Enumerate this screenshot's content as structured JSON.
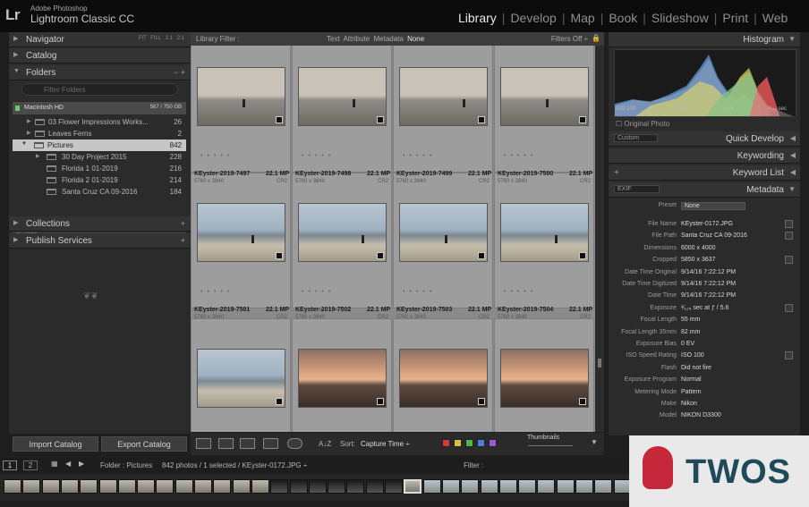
{
  "app": {
    "badge": "Lr",
    "vendor": "Adobe Photoshop",
    "name": "Lightroom Classic CC"
  },
  "modules": [
    "Library",
    "Develop",
    "Map",
    "Book",
    "Slideshow",
    "Print",
    "Web"
  ],
  "active_module": "Library",
  "left_panel": {
    "navigator": {
      "title": "Navigator",
      "zoom_options": [
        "FIT",
        "FILL",
        "1:1",
        "2:1"
      ]
    },
    "catalog": {
      "title": "Catalog"
    },
    "folders": {
      "title": "Folders",
      "actions": [
        "−",
        "+"
      ],
      "filter_placeholder": "Filter Folders",
      "volume": {
        "name": "Macintosh HD",
        "space": "567 / 750 GB"
      },
      "items": [
        {
          "name": "03 Flower Impressions Works...",
          "count": "26"
        },
        {
          "name": "Leaves Ferns",
          "count": "2"
        },
        {
          "name": "Pictures",
          "count": "842"
        },
        {
          "name": "30 Day Project 2015",
          "count": "228"
        },
        {
          "name": "Florida 1 01-2019",
          "count": "216"
        },
        {
          "name": "Florida 2 01-2019",
          "count": "214"
        },
        {
          "name": "Santa Cruz CA 09-2016",
          "count": "184"
        }
      ],
      "section": "EYSTER"
    },
    "collections": {
      "title": "Collections",
      "action": "+"
    },
    "publish": {
      "title": "Publish Services",
      "action": "+"
    },
    "import_label": "Import Catalog",
    "export_label": "Export Catalog"
  },
  "filter_bar": {
    "label": "Library Filter :",
    "options": [
      "Text",
      "Attribute",
      "Metadata",
      "None"
    ],
    "active": "None",
    "filters_off": "Filters Off ÷"
  },
  "grid_cells": [
    {
      "name": "KEyster-2019-7497",
      "size": "22.1 MP",
      "dims": "5760 x 3840",
      "type": "CR2"
    },
    {
      "name": "KEyster-2019-7498",
      "size": "22.1 MP",
      "dims": "5760 x 3840",
      "type": "CR2"
    },
    {
      "name": "KEyster-2019-7499",
      "size": "22.1 MP",
      "dims": "5760 x 3840",
      "type": "CR2"
    },
    {
      "name": "KEyster-2019-7500",
      "size": "22.1 MP",
      "dims": "5760 x 3840",
      "type": "CR2"
    },
    {
      "name": "KEyster-2019-7501",
      "size": "22.1 MP",
      "dims": "5760 x 3840",
      "type": "CR2"
    },
    {
      "name": "KEyster-2019-7502",
      "size": "22.1 MP",
      "dims": "5760 x 3840",
      "type": "CR2"
    },
    {
      "name": "KEyster-2019-7503",
      "size": "22.1 MP",
      "dims": "5760 x 3840",
      "type": "CR2"
    },
    {
      "name": "KEyster-2019-7504",
      "size": "22.1 MP",
      "dims": "5760 x 3840",
      "type": "CR2"
    }
  ],
  "toolbar": {
    "sort_label": "Sort:",
    "sort_value": "Capture Time ÷",
    "thumbnails_label": "Thumbnails",
    "az_icon": "A↓Z",
    "label_colors": [
      "#d33a3a",
      "#d8c23a",
      "#4db54d",
      "#4b7fd6",
      "#9a5bd0"
    ]
  },
  "right_panel": {
    "histogram": {
      "title": "Histogram",
      "iso": "ISO 100",
      "focal": "55 mm",
      "aperture": "f / 5.6",
      "shutter": "¹⁄₁₂₅ sec",
      "original_photo": "Original Photo"
    },
    "quick_develop": {
      "title": "Quick Develop",
      "preset": "Custom"
    },
    "keywording": {
      "title": "Keywording"
    },
    "keyword_list": {
      "title": "Keyword List",
      "action": "+"
    },
    "metadata": {
      "title": "Metadata",
      "mode": "EXIF",
      "preset_label": "Preset",
      "preset_value": "None",
      "rows": [
        {
          "k": "File Name",
          "v": "KEyster-0172.JPG"
        },
        {
          "k": "File Path",
          "v": "Santa Cruz CA 09-2016"
        },
        {
          "k": "Dimensions",
          "v": "6000 x 4000"
        },
        {
          "k": "Cropped",
          "v": "5850 x 3637"
        },
        {
          "k": "Date Time Original",
          "v": "9/14/16 7:22:12 PM"
        },
        {
          "k": "Date Time Digitized",
          "v": "9/14/16 7:22:12 PM"
        },
        {
          "k": "Date Time",
          "v": "9/14/16 7:22:12 PM"
        },
        {
          "k": "Exposure",
          "v": "¹⁄₁₂₅ sec at ƒ / 5.6"
        },
        {
          "k": "Focal Length",
          "v": "55 mm"
        },
        {
          "k": "Focal Length 35mm",
          "v": "82 mm"
        },
        {
          "k": "Exposure Bias",
          "v": "0 EV"
        },
        {
          "k": "ISO Speed Rating",
          "v": "ISO 100"
        },
        {
          "k": "Flash",
          "v": "Did not fire"
        },
        {
          "k": "Exposure Program",
          "v": "Normal"
        },
        {
          "k": "Metering Mode",
          "v": "Pattern"
        },
        {
          "k": "Make",
          "v": "Nikon"
        },
        {
          "k": "Model",
          "v": "NIKON D3300"
        }
      ]
    }
  },
  "filmstrip": {
    "page1": "1",
    "page2": "2",
    "source_label": "Folder : Pictures",
    "count_text": "842 photos / 1 selected / KEyster-0172.JPG ÷",
    "filter_label": "Filter :"
  },
  "watermark": {
    "text": "TWOS"
  }
}
